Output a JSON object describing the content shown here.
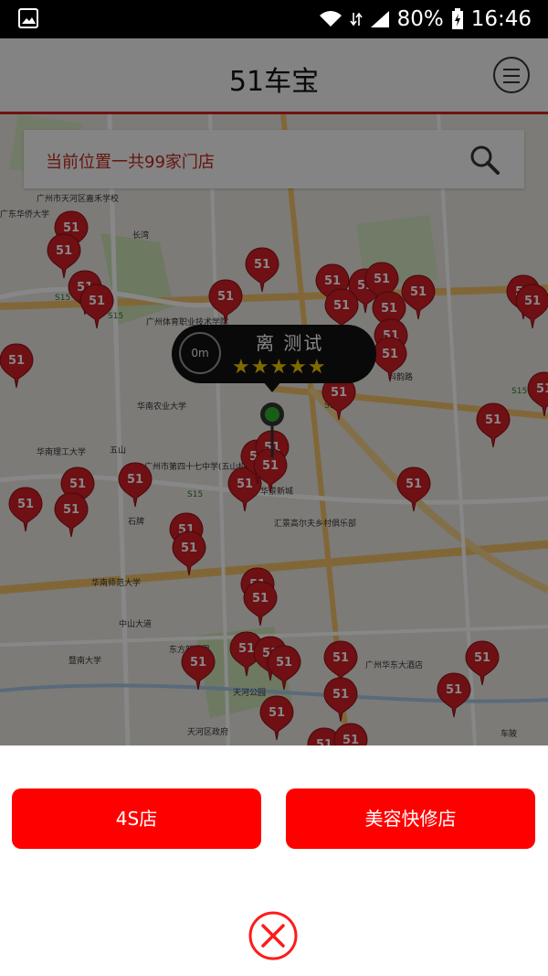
{
  "status_bar": {
    "battery": "80%",
    "time": "16:46"
  },
  "header": {
    "title": "51车宝"
  },
  "search": {
    "text": "当前位置一共99家门店"
  },
  "map": {
    "pin_label": "51",
    "road_labels": [
      "S15",
      "S15",
      "S15",
      "S15",
      "S15"
    ],
    "place_labels": [
      "广州市天河区嘉禾学校",
      "长湾",
      "广东华侨大学",
      "五山",
      "华南理工大学",
      "华南农业大学",
      "华南师范大学",
      "广州体育职业技术学院",
      "天河公园",
      "暨南大学",
      "石牌",
      "东方新世界",
      "中山大道",
      "车陂",
      "广州市第四十七中学(五山校区)",
      "汇景高尔夫乡村俱乐部",
      "天河区政府",
      "华景新城",
      "广州华东大酒店",
      "科韵路"
    ]
  },
  "callout": {
    "distance": "0m",
    "name": "离 测试",
    "rating": 5
  },
  "actions": {
    "btn_4s": "4S店",
    "btn_repair": "美容快修店"
  }
}
